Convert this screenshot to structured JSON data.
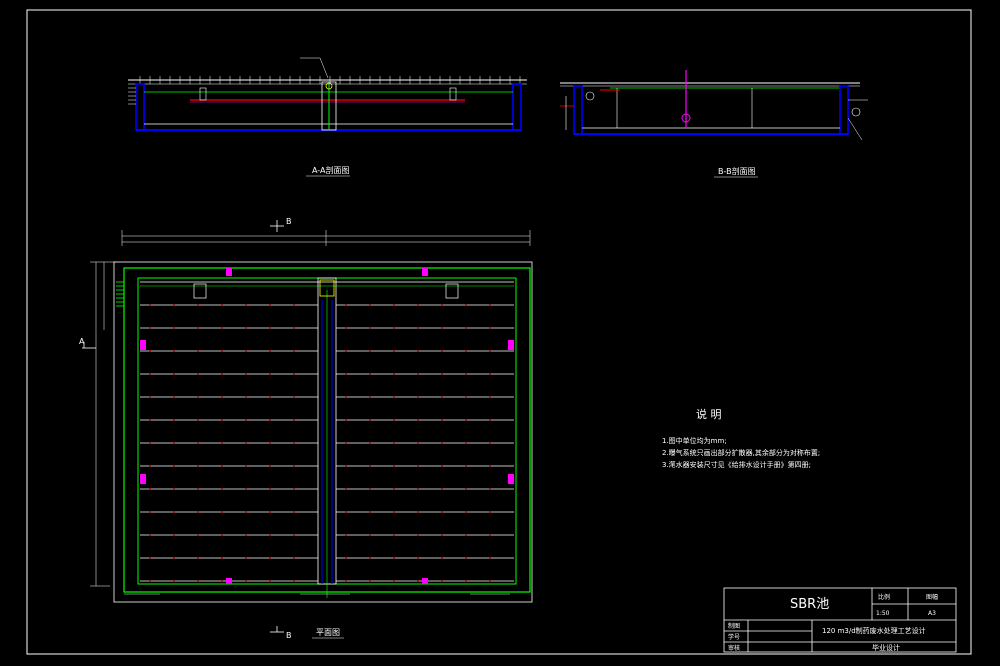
{
  "section_aa_title": "A-A剖面图",
  "section_bb_title": "B-B剖面图",
  "plan_title": "平面图",
  "section_mark_a": "A",
  "section_mark_b": "B",
  "notes": {
    "heading": "说   明",
    "items": [
      "1.图中单位均为mm;",
      "2.曝气系统只画出部分扩散器,其余部分为对称布置;",
      "3.滗水器安装尺寸见《给排水设计手册》第四册;"
    ]
  },
  "title_block": {
    "drawing_name": "SBR池",
    "scale_label": "比例",
    "scale_value": "1:50",
    "sheet_label": "图幅",
    "sheet_value": "A3",
    "project": "120 m3/d制药废水处理工艺设计",
    "drawn_label": "制图",
    "id_label": "学号",
    "review_label": "审核",
    "footer": "毕业设计"
  },
  "colors": {
    "outline": "#00ff00",
    "wall": "#0000ff",
    "pipe_red": "#ff0000",
    "magenta": "#ff00ff",
    "yellow": "#ffff00",
    "cyan": "#00ffff",
    "line": "#ffffff"
  }
}
